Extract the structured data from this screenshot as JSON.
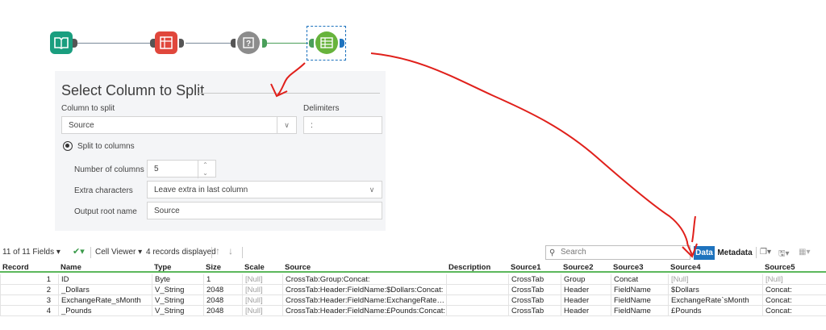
{
  "workflow": {
    "tools": [
      {
        "name": "input-data-tool",
        "color": "#1a9e7f"
      },
      {
        "name": "crosstab-tool",
        "color": "#e0473c"
      },
      {
        "name": "summarize-tool",
        "color": "#8c8c8c"
      },
      {
        "name": "text-to-columns-tool",
        "color": "#67b33c",
        "selected": true
      }
    ]
  },
  "config": {
    "title": "Select Column to Split",
    "column_label": "Column to split",
    "column_value": "Source",
    "delimiters_label": "Delimiters",
    "delimiters_value": ":",
    "split_option": "Split to columns",
    "num_columns_label": "Number of columns",
    "num_columns_value": "5",
    "extra_label": "Extra characters",
    "extra_value": "Leave extra in last column",
    "output_label": "Output root name",
    "output_value": "Source"
  },
  "toolbar": {
    "fields_count": "11 of 11 Fields",
    "cell_viewer": "Cell Viewer",
    "records": "4 records displayed",
    "search_placeholder": "Search",
    "data_label": "Data",
    "metadata_label": "Metadata"
  },
  "grid": {
    "headers": [
      "Record",
      "Name",
      "Type",
      "Size",
      "Scale",
      "Source",
      "Description",
      "Source1",
      "Source2",
      "Source3",
      "Source4",
      "Source5"
    ],
    "rows": [
      [
        "1",
        "ID",
        "Byte",
        "1",
        "[Null]",
        "CrossTab:Group:Concat:",
        "",
        "CrossTab",
        "Group",
        "Concat",
        "[Null]",
        "[Null]"
      ],
      [
        "2",
        "_Dollars",
        "V_String",
        "2048",
        "[Null]",
        "CrossTab:Header:FieldName:$Dollars:Concat:",
        "",
        "CrossTab",
        "Header",
        "FieldName",
        "$Dollars",
        "Concat:"
      ],
      [
        "3",
        "ExchangeRate_sMonth",
        "V_String",
        "2048",
        "[Null]",
        "CrossTab:Header:FieldName:ExchangeRate`sMont...",
        "",
        "CrossTab",
        "Header",
        "FieldName",
        "ExchangeRate`sMonth",
        "Concat:"
      ],
      [
        "4",
        "_Pounds",
        "V_String",
        "2048",
        "[Null]",
        "CrossTab:Header:FieldName:£Pounds:Concat:",
        "",
        "CrossTab",
        "Header",
        "FieldName",
        "£Pounds",
        "Concat:"
      ]
    ]
  },
  "colors": {
    "accent": "#1e73be",
    "annotation": "#e0201b",
    "header_underline": "#5cb85c"
  }
}
